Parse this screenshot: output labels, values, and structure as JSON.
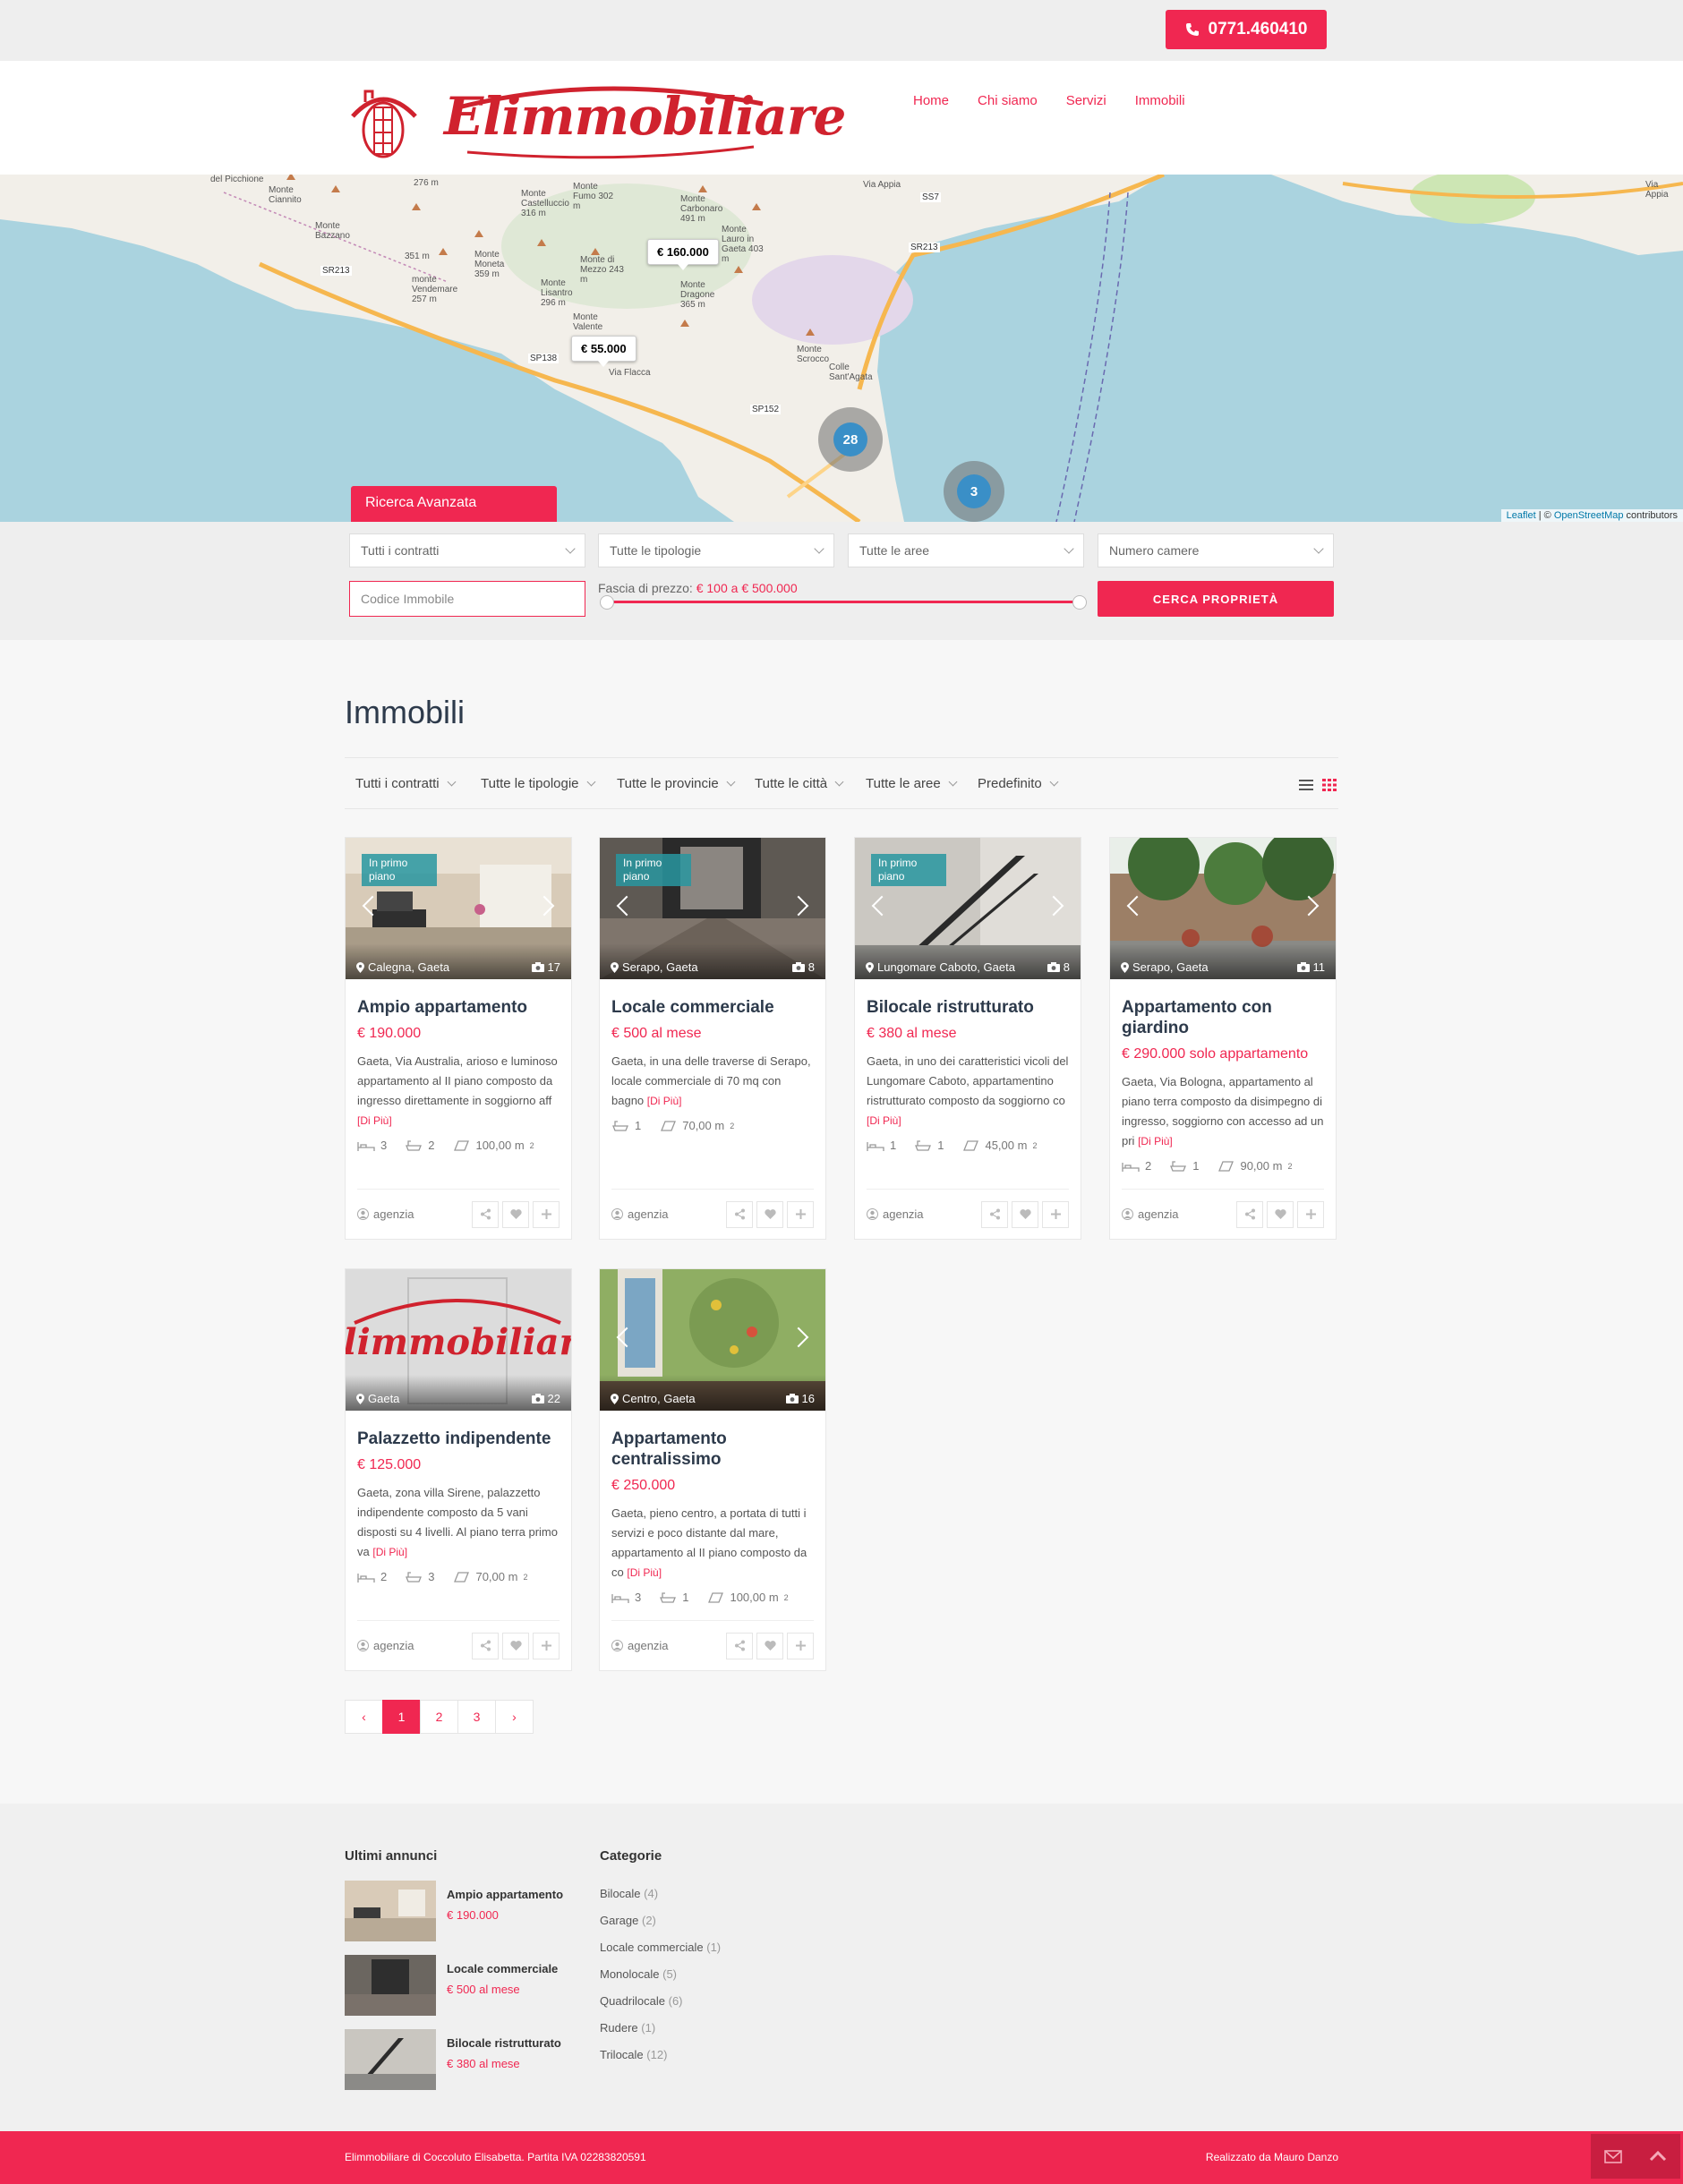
{
  "topbar": {
    "phone": "0771.460410"
  },
  "brand": {
    "name": "Elimmobiliare"
  },
  "nav": [
    {
      "label": "Home"
    },
    {
      "label": "Chi siamo"
    },
    {
      "label": "Servizi"
    },
    {
      "label": "Immobili"
    }
  ],
  "map": {
    "pins": [
      {
        "label": "€ 160.000"
      },
      {
        "label": "€ 55.000"
      }
    ],
    "clusters": [
      {
        "label": "28"
      },
      {
        "label": "3"
      }
    ],
    "labels": [
      "Monte Ciannito",
      "Monte Bazzano",
      "SR213",
      "351 m",
      "monte Vendemare 257 m",
      "Monte Moneta 359 m",
      "Monte Castelluccio 316 m",
      "Monte Fumo 302 m",
      "Monte di Mezzo 243 m",
      "Monte Lisantro 296 m",
      "Monte Valente",
      "SP138",
      "Via Flacca",
      "Monte Carbonaro 491 m",
      "Monte Lauro in Gaeta 403 m",
      "Monte Dragone 365 m",
      "SS7",
      "SR213",
      "Via Appia",
      "Monte Scrocco",
      "Colle Sant'Agata",
      "SP152",
      "Via Appia",
      "276 m",
      "del Picchione"
    ],
    "attribution": {
      "leaflet": "Leaflet",
      "sep": " | © ",
      "osm": "OpenStreetMap",
      "tail": " contributors"
    }
  },
  "search": {
    "tab": "Ricerca Avanzata",
    "contracts": "Tutti i contratti",
    "types": "Tutte le tipologie",
    "areas": "Tutte le aree",
    "rooms": "Numero camere",
    "code_placeholder": "Codice Immobile",
    "price_label": "Fascia di prezzo:",
    "price_range": "€ 100 a € 500.000",
    "price_min_fraction": 0,
    "price_max_fraction": 1,
    "button": "CERCA PROPRIETÀ"
  },
  "listing": {
    "title": "Immobili",
    "filters": [
      "Tutti i contratti",
      "Tutte le tipologie",
      "Tutte le provincie",
      "Tutte le città",
      "Tutte le aree",
      "Predefinito"
    ],
    "more_label": "[Di Più]",
    "agent_label": "agenzia",
    "cards": [
      {
        "badge": "In primo piano",
        "location": "Calegna, Gaeta",
        "photos": "17",
        "title": "Ampio appartamento",
        "price": "€ 190.000",
        "desc": "Gaeta, Via Australia, arioso e luminoso appartamento al II piano composto da ingresso direttamente in soggiorno aff",
        "beds": "3",
        "baths": "2",
        "area": "100,00 m",
        "scene": "room"
      },
      {
        "badge": "In primo piano",
        "location": "Serapo, Gaeta",
        "photos": "8",
        "title": "Locale commerciale",
        "price": "€ 500 al mese",
        "desc": "Gaeta, in una delle traverse di Serapo, locale commerciale di 70 mq con bagno",
        "beds": "",
        "baths": "1",
        "area": "70,00 m",
        "scene": "shop"
      },
      {
        "badge": "In primo piano",
        "location": "Lungomare Caboto, Gaeta",
        "photos": "8",
        "title": "Bilocale ristrutturato",
        "price": "€ 380 al mese",
        "desc": "Gaeta, in uno dei caratteristici vicoli del Lungomare Caboto, appartamentino ristrutturato composto da soggiorno co",
        "beds": "1",
        "baths": "1",
        "area": "45,00 m",
        "scene": "stairs"
      },
      {
        "badge": "",
        "location": "Serapo, Gaeta",
        "photos": "11",
        "title": "Appartamento con giardino",
        "price": "€ 290.000 solo appartamento",
        "desc": "Gaeta, Via Bologna, appartamento al piano terra composto da disimpegno di ingresso, soggiorno con accesso ad un pri",
        "beds": "2",
        "baths": "1",
        "area": "90,00 m",
        "scene": "garden"
      },
      {
        "badge": "",
        "location": "Gaeta",
        "photos": "22",
        "title": "Palazzetto indipendente",
        "price": "€ 125.000",
        "desc": "Gaeta, zona villa Sirene, palazzetto indipendente composto da 5 vani disposti su 4 livelli. Al piano terra primo va",
        "beds": "2",
        "baths": "3",
        "area": "70,00 m",
        "scene": "logo"
      },
      {
        "badge": "",
        "location": "Centro, Gaeta",
        "photos": "16",
        "title": "Appartamento centralissimo",
        "price": "€ 250.000",
        "desc": "Gaeta, pieno centro, a portata di tutti i servizi e poco distante dal mare, appartamento al II piano composto da co",
        "beds": "3",
        "baths": "1",
        "area": "100,00 m",
        "scene": "green"
      }
    ],
    "pages": [
      "‹",
      "1",
      "2",
      "3",
      "›"
    ]
  },
  "footer": {
    "recent_title": "Ultimi annunci",
    "recent": [
      {
        "title": "Ampio appartamento",
        "price": "€ 190.000"
      },
      {
        "title": "Locale commerciale",
        "price": "€ 500 al mese"
      },
      {
        "title": "Bilocale ristrutturato",
        "price": "€ 380 al mese"
      }
    ],
    "categories_title": "Categorie",
    "categories": [
      {
        "name": "Bilocale",
        "count": "(4)"
      },
      {
        "name": "Garage",
        "count": "(2)"
      },
      {
        "name": "Locale commerciale",
        "count": "(1)"
      },
      {
        "name": "Monolocale",
        "count": "(5)"
      },
      {
        "name": "Quadrilocale",
        "count": "(6)"
      },
      {
        "name": "Rudere",
        "count": "(1)"
      },
      {
        "name": "Trilocale",
        "count": "(12)"
      }
    ],
    "copyright": "Elimmobiliare di Coccoluto Elisabetta. Partita IVA 02283820591",
    "credit": "Realizzato da Mauro Danzo"
  },
  "colors": {
    "accent": "#f02751",
    "title": "#2d3a4b",
    "sea": "#aad3df",
    "land": "#f2efe9"
  },
  "icons": [
    "phone-icon",
    "map-marker-icon",
    "camera-icon",
    "bed-icon",
    "bath-icon",
    "area-icon",
    "user-icon",
    "share-icon",
    "heart-icon",
    "plus-icon",
    "list-view-icon",
    "grid-view-icon",
    "envelope-icon",
    "chevron-up-icon"
  ]
}
